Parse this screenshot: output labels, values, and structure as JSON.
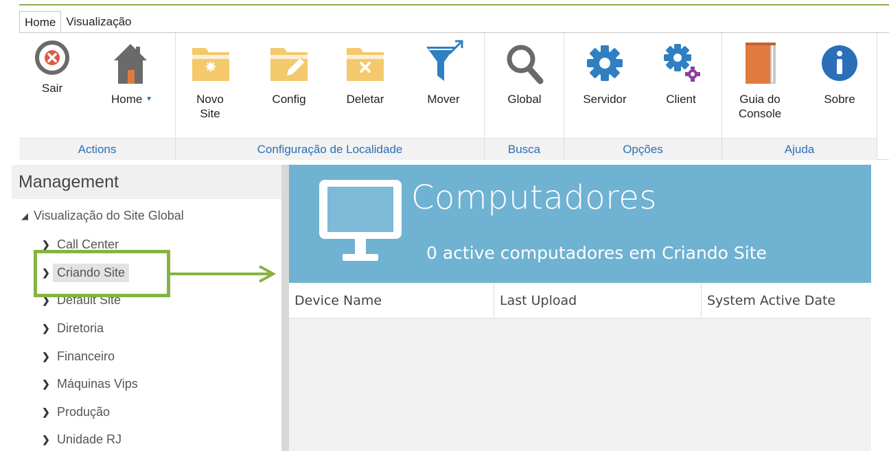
{
  "tabs": [
    {
      "label": "Home",
      "active": true
    },
    {
      "label": "Visualização",
      "active": false
    }
  ],
  "ribbon": {
    "groups": [
      {
        "label": "Actions",
        "buttons": [
          {
            "label_line1": "Sair",
            "label_line2": "",
            "icon": "close-circle-icon"
          },
          {
            "label_line1": "Home",
            "label_line2": "",
            "icon": "house-icon",
            "has_dropdown": true
          }
        ]
      },
      {
        "label": "Configuração de Localidade",
        "buttons": [
          {
            "label_line1": "Novo",
            "label_line2": "Site",
            "icon": "new-folder-icon"
          },
          {
            "label_line1": "Config",
            "label_line2": "",
            "icon": "edit-folder-icon"
          },
          {
            "label_line1": "Deletar",
            "label_line2": "",
            "icon": "delete-folder-icon"
          },
          {
            "label_line1": "Mover",
            "label_line2": "",
            "icon": "filter-icon"
          }
        ]
      },
      {
        "label": "Busca",
        "buttons": [
          {
            "label_line1": "Global",
            "label_line2": "",
            "icon": "magnifier-icon"
          }
        ]
      },
      {
        "label": "Opções",
        "buttons": [
          {
            "label_line1": "Servidor",
            "label_line2": "",
            "icon": "gear-icon"
          },
          {
            "label_line1": "Client",
            "label_line2": "",
            "icon": "gears-icon"
          }
        ]
      },
      {
        "label": "Ajuda",
        "buttons": [
          {
            "label_line1": "Guia do",
            "label_line2": "Console",
            "icon": "book-icon"
          },
          {
            "label_line1": "Sobre",
            "label_line2": "",
            "icon": "info-icon"
          }
        ]
      }
    ]
  },
  "left_pane": {
    "header": "Management",
    "root": "Visualização do Site Global",
    "items": [
      {
        "label": "Call Center",
        "selected": false
      },
      {
        "label": "Criando Site",
        "selected": true
      },
      {
        "label": "Default Site",
        "selected": false
      },
      {
        "label": "Diretoria",
        "selected": false
      },
      {
        "label": "Financeiro",
        "selected": false
      },
      {
        "label": "Máquinas Vips",
        "selected": false
      },
      {
        "label": "Produção",
        "selected": false
      },
      {
        "label": "Unidade RJ",
        "selected": false
      }
    ]
  },
  "hero": {
    "title": "Computadores",
    "subtitle": "0 active computadores em Criando Site",
    "icon": "monitor-icon"
  },
  "table": {
    "columns": [
      "Device Name",
      "Last Upload",
      "System Active Date"
    ]
  },
  "colors": {
    "accent_green": "#86b342",
    "hero_blue": "#6fb2d2",
    "group_label_blue": "#2a6fb8",
    "folder_yellow": "#f4c96b",
    "gear_blue": "#2f7fc2",
    "info_blue": "#2a6fb8",
    "close_red": "#e05a47",
    "book_orange": "#e07a3f"
  }
}
